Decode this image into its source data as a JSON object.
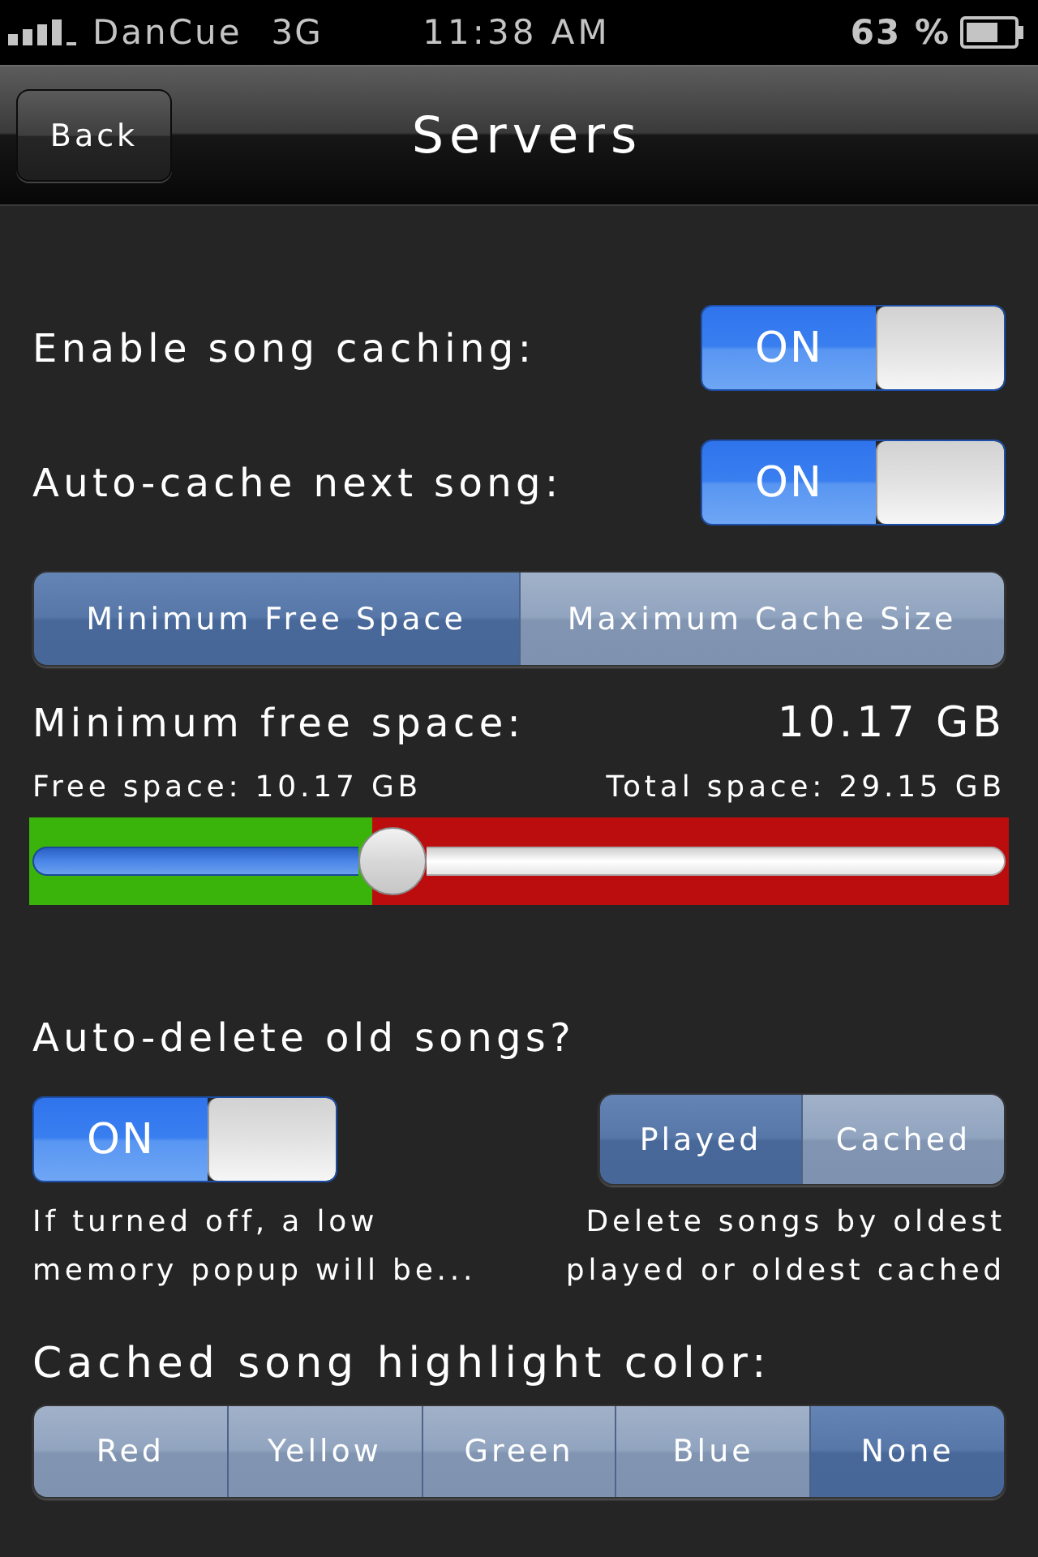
{
  "status_bar": {
    "carrier": "DanCue",
    "network": "3G",
    "time": "11:38 AM",
    "battery": "63 %"
  },
  "nav_bar": {
    "back_button": "Back",
    "title": "Servers"
  },
  "caching_switches": [
    {
      "label": "Enable song caching:",
      "switch_label": "ON",
      "on": true
    },
    {
      "label": "Auto-cache next song:",
      "switch_label": "ON",
      "on": true
    }
  ],
  "space_mode": {
    "segments": [
      {
        "label": "Minimum Free Space",
        "selected": true
      },
      {
        "label": "Maximum Cache Size",
        "selected": false
      }
    ]
  },
  "minimum_free_space": {
    "label": "Minimum free space:",
    "value": "10.17 GB",
    "free_space": "Free space: 10.17 GB",
    "total_space": "Total space: 29.15 GB",
    "space_bar": {
      "level": 0.35
    },
    "slider": {
      "level": 0.36
    }
  },
  "auto_delete": {
    "label": "Auto-delete old songs?",
    "switch": {
      "switch_label": "ON",
      "on": true
    },
    "order": {
      "segments": [
        {
          "label": "Played",
          "selected": true
        },
        {
          "label": "Cached",
          "selected": false
        }
      ]
    },
    "switch_note": [
      "If turned off, a low",
      "memory popup will be..."
    ],
    "order_note": [
      "Delete songs by oldest",
      "played or oldest cached"
    ]
  },
  "highlight_color": {
    "label": "Cached song highlight color:",
    "segments": [
      {
        "label": "Red",
        "selected": false
      },
      {
        "label": "Yellow",
        "selected": false
      },
      {
        "label": "Green",
        "selected": false
      },
      {
        "label": "Blue",
        "selected": false
      },
      {
        "label": "None",
        "selected": true
      }
    ]
  }
}
